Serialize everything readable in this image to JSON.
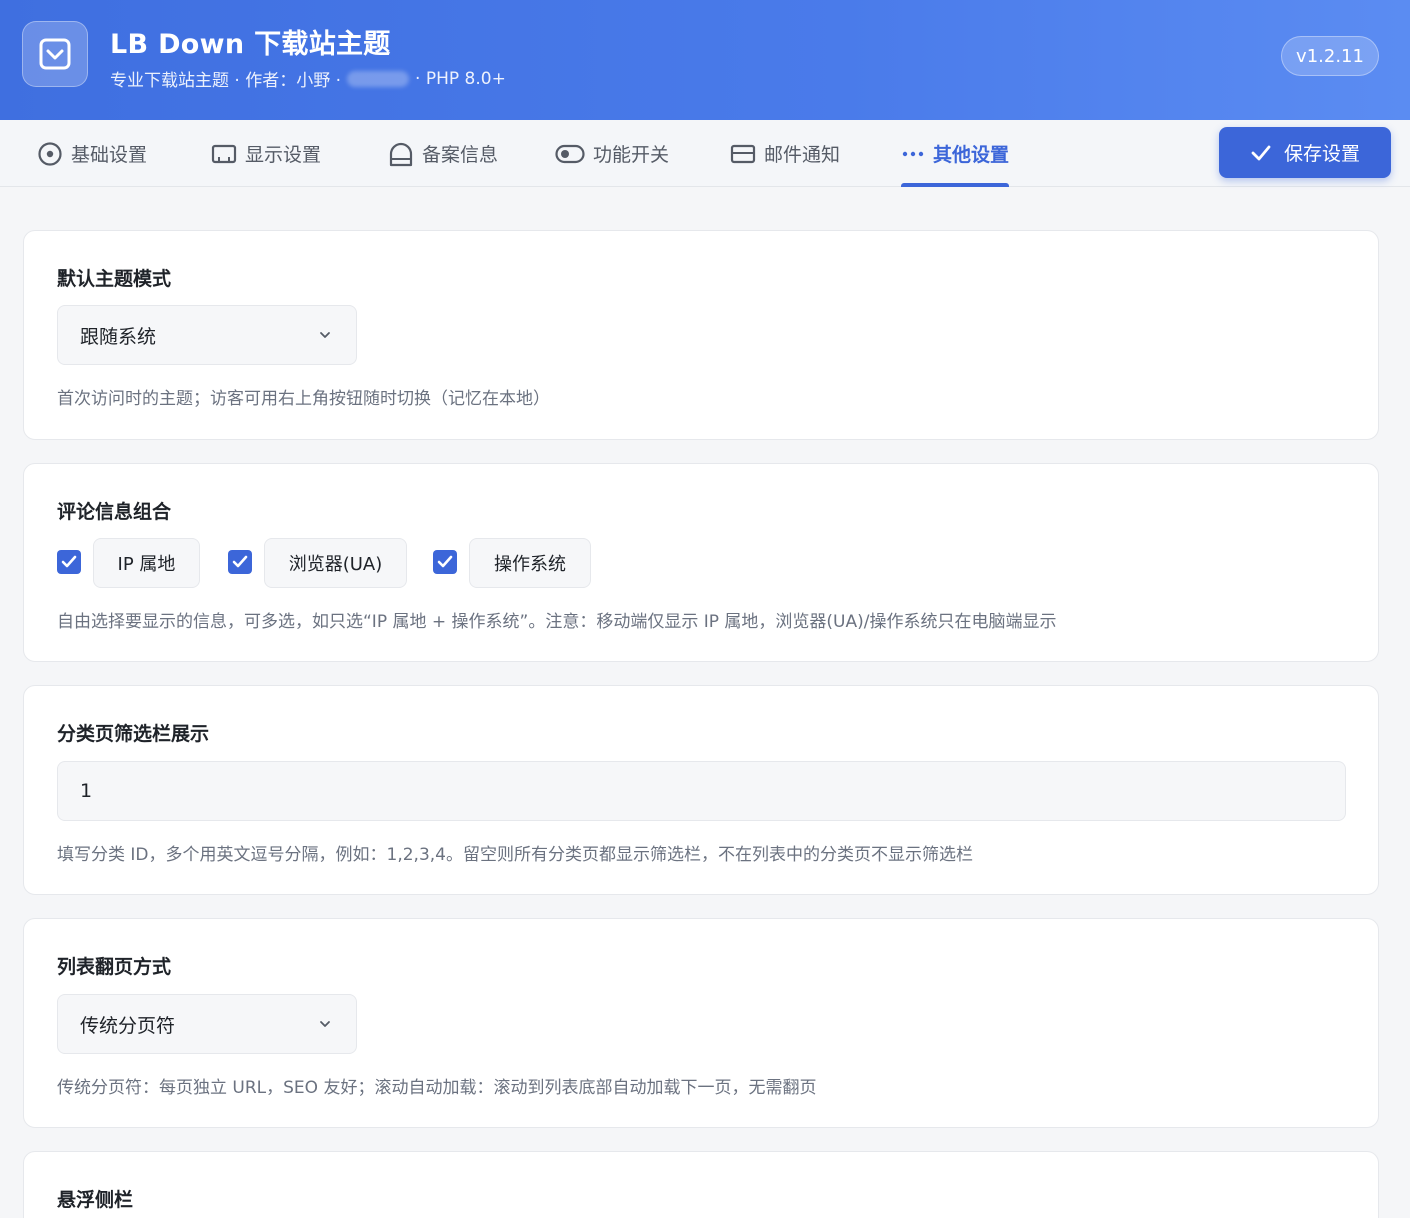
{
  "header": {
    "title": "LB Down 下载站主题",
    "subtitle_left": "专业下载站主题 · 作者：小野 ·",
    "subtitle_right": "· PHP 8.0+",
    "version": "v1.2.11"
  },
  "tabs": [
    {
      "label": "基础设置",
      "icon": "circle-dot-icon",
      "active": false
    },
    {
      "label": "显示设置",
      "icon": "monitor-icon",
      "active": false
    },
    {
      "label": "备案信息",
      "icon": "shield-icon",
      "active": false
    },
    {
      "label": "功能开关",
      "icon": "toggle-icon",
      "active": false
    },
    {
      "label": "邮件通知",
      "icon": "mail-icon",
      "active": false
    },
    {
      "label": "其他设置",
      "icon": "more-dots-icon",
      "active": true
    }
  ],
  "toolbar": {
    "save_label": "保存设置"
  },
  "sections": {
    "theme_mode": {
      "title": "默认主题模式",
      "value": "跟随系统",
      "hint": "首次访问时的主题；访客可用右上角按钮随时切换（记忆在本地）"
    },
    "comment_info": {
      "title": "评论信息组合",
      "options": [
        {
          "label": "IP 属地",
          "checked": true
        },
        {
          "label": "浏览器(UA)",
          "checked": true
        },
        {
          "label": "操作系统",
          "checked": true
        }
      ],
      "hint": "自由选择要显示的信息，可多选，如只选“IP 属地 + 操作系统”。注意：移动端仅显示 IP 属地，浏览器(UA)/操作系统只在电脑端显示"
    },
    "category_filter": {
      "title": "分类页筛选栏展示",
      "value": "1",
      "hint": "填写分类 ID，多个用英文逗号分隔，例如：1,2,3,4。留空则所有分类页都显示筛选栏，不在列表中的分类页不显示筛选栏"
    },
    "pagination": {
      "title": "列表翻页方式",
      "value": "传统分页符",
      "hint": "传统分页符：每页独立 URL，SEO 友好；滚动自动加载：滚动到列表底部自动加载下一页，无需翻页"
    },
    "floating_sidebar": {
      "title": "悬浮侧栏"
    }
  },
  "colors": {
    "accent": "#3c66d9",
    "header_gradient_start": "#3f6fe0",
    "header_gradient_end": "#5b8cf2"
  }
}
